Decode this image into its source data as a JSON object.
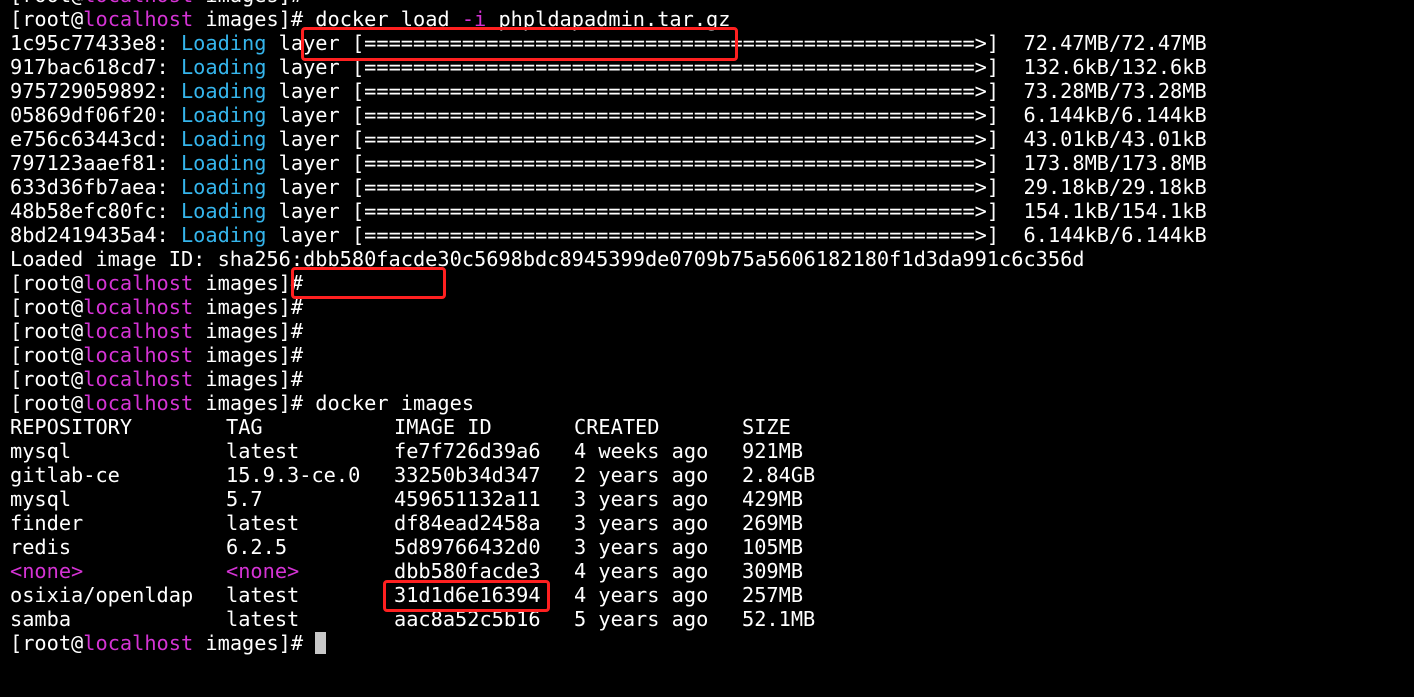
{
  "prompt": {
    "open": "[",
    "user": "root@",
    "host": "localhost",
    "dir_close": " images]#"
  },
  "load_cmd": {
    "before": " docker load ",
    "flag": "-i",
    "after": " phpldapadmin.tar.gz"
  },
  "layers": [
    {
      "id": "1c95c77433e8:",
      "status": "Loading",
      "word": "layer",
      "bar": "[==================================================>]",
      "size": "72.47MB/72.47MB"
    },
    {
      "id": "917bac618cd7:",
      "status": "Loading",
      "word": "layer",
      "bar": "[==================================================>]",
      "size": "132.6kB/132.6kB"
    },
    {
      "id": "975729059892:",
      "status": "Loading",
      "word": "layer",
      "bar": "[==================================================>]",
      "size": "73.28MB/73.28MB"
    },
    {
      "id": "05869df06f20:",
      "status": "Loading",
      "word": "layer",
      "bar": "[==================================================>]",
      "size": "6.144kB/6.144kB"
    },
    {
      "id": "e756c63443cd:",
      "status": "Loading",
      "word": "layer",
      "bar": "[==================================================>]",
      "size": "43.01kB/43.01kB"
    },
    {
      "id": "797123aaef81:",
      "status": "Loading",
      "word": "layer",
      "bar": "[==================================================>]",
      "size": "173.8MB/173.8MB"
    },
    {
      "id": "633d36fb7aea:",
      "status": "Loading",
      "word": "layer",
      "bar": "[==================================================>]",
      "size": "29.18kB/29.18kB"
    },
    {
      "id": "48b58efc80fc:",
      "status": "Loading",
      "word": "layer",
      "bar": "[==================================================>]",
      "size": "154.1kB/154.1kB"
    },
    {
      "id": "8bd2419435a4:",
      "status": "Loading",
      "word": "layer",
      "bar": "[==================================================>]",
      "size": "6.144kB/6.144kB"
    }
  ],
  "loaded_image": "Loaded image ID: sha256:dbb580facde30c5698bdc8945399de0709b75a5606182180f1d3da991c6c356d",
  "images_cmd": " docker images",
  "table": {
    "headers": [
      "REPOSITORY",
      "TAG",
      "IMAGE ID",
      "CREATED",
      "SIZE"
    ],
    "rows": [
      [
        "mysql",
        "latest",
        "fe7f726d39a6",
        "4 weeks ago",
        "921MB"
      ],
      [
        "gitlab-ce",
        "15.9.3-ce.0",
        "33250b34d347",
        "2 years ago",
        "2.84GB"
      ],
      [
        "mysql",
        "5.7",
        "459651132a11",
        "3 years ago",
        "429MB"
      ],
      [
        "finder",
        "latest",
        "df84ead2458a",
        "3 years ago",
        "269MB"
      ],
      [
        "redis",
        "6.2.5",
        "5d89766432d0",
        "3 years ago",
        "105MB"
      ],
      [
        "<none>",
        "<none>",
        "dbb580facde3",
        "4 years ago",
        "309MB"
      ],
      [
        "osixia/openldap",
        "latest",
        "31d1d6e16394",
        "4 years ago",
        "257MB"
      ],
      [
        "samba",
        "latest",
        "aac8a52c5b16",
        "5 years ago",
        "52.1MB"
      ]
    ]
  },
  "colors": {
    "background": "#000000",
    "text": "#ffffff",
    "host": "#d433d4",
    "loading": "#35b5ec",
    "highlight": "#ff2020"
  }
}
